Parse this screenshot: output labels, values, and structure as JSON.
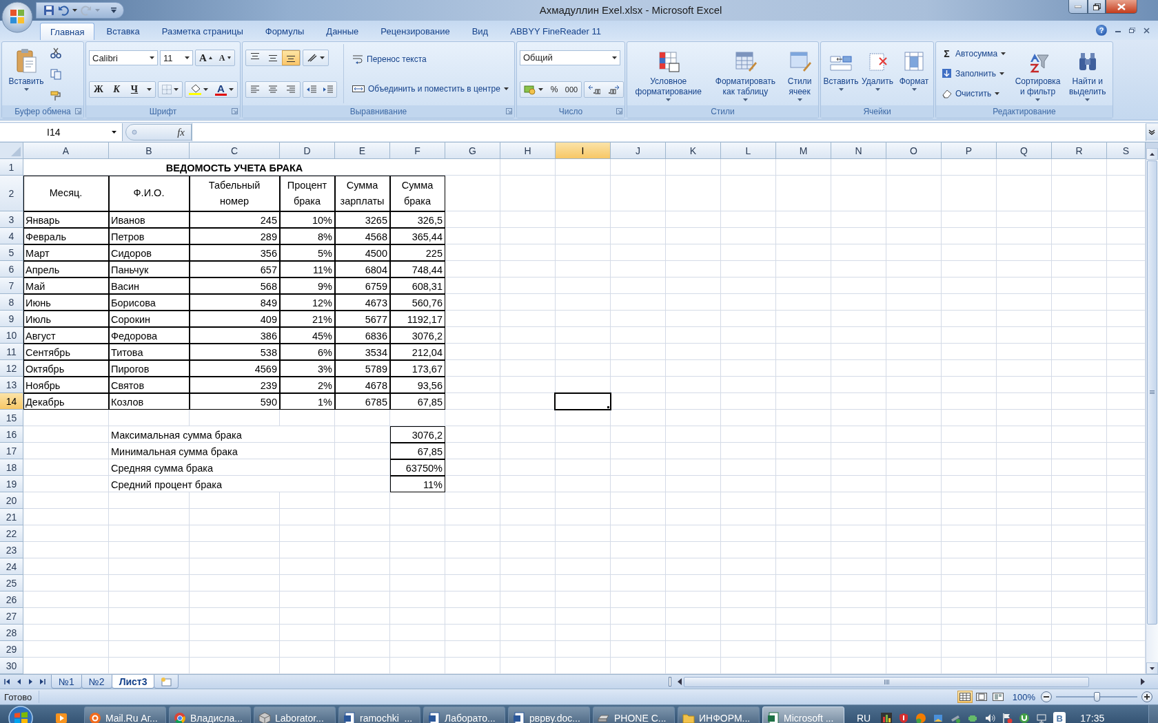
{
  "window": {
    "title": "Ахмадуллин Exel.xlsx - Microsoft Excel"
  },
  "ribbon_tabs": [
    {
      "label": "Главная",
      "selected": true
    },
    {
      "label": "Вставка",
      "selected": false
    },
    {
      "label": "Разметка страницы",
      "selected": false
    },
    {
      "label": "Формулы",
      "selected": false
    },
    {
      "label": "Данные",
      "selected": false
    },
    {
      "label": "Рецензирование",
      "selected": false
    },
    {
      "label": "Вид",
      "selected": false
    },
    {
      "label": "ABBYY FineReader 11",
      "selected": false
    }
  ],
  "help": "?",
  "ribbon": {
    "clipboard": {
      "label": "Буфер обмена",
      "paste": "Вставить"
    },
    "font": {
      "label": "Шрифт",
      "name": "Calibri",
      "size": "11",
      "grow": "A",
      "shrink": "A",
      "bold": "Ж",
      "italic": "К",
      "underline": "Ч",
      "font_color": "A"
    },
    "alignment": {
      "label": "Выравнивание",
      "vertical": [
        {
          "selected": false
        },
        {
          "selected": false
        },
        {
          "selected": true
        }
      ],
      "wrap": "Перенос текста",
      "merge": "Объединить и поместить в центре"
    },
    "number": {
      "label": "Число",
      "format": "Общий",
      "percent": "%",
      "thousands": "000"
    },
    "styles": {
      "label": "Стили",
      "buttons": [
        "Условное форматирование",
        "Форматировать как таблицу",
        "Стили ячеек"
      ]
    },
    "cells": {
      "label": "Ячейки",
      "buttons": [
        "Вставить",
        "Удалить",
        "Формат"
      ]
    },
    "editing": {
      "label": "Редактирование",
      "autosum_sign": "Σ",
      "items": [
        "Автосумма",
        "Заполнить",
        "Очистить"
      ],
      "sort": "Сортировка и фильтр",
      "find": "Найти и выделить"
    }
  },
  "formula_bar": {
    "name_box": "I14",
    "function_label": "fx"
  },
  "columns": [
    {
      "label": "A",
      "selected": false
    },
    {
      "label": "B",
      "selected": false
    },
    {
      "label": "C",
      "selected": false
    },
    {
      "label": "D",
      "selected": false
    },
    {
      "label": "E",
      "selected": false
    },
    {
      "label": "F",
      "selected": false
    },
    {
      "label": "G",
      "selected": false
    },
    {
      "label": "H",
      "selected": false
    },
    {
      "label": "I",
      "selected": true
    },
    {
      "label": "J",
      "selected": false
    },
    {
      "label": "K",
      "selected": false
    },
    {
      "label": "L",
      "selected": false
    },
    {
      "label": "M",
      "selected": false
    },
    {
      "label": "N",
      "selected": false
    },
    {
      "label": "O",
      "selected": false
    },
    {
      "label": "P",
      "selected": false
    },
    {
      "label": "Q",
      "selected": false
    },
    {
      "label": "R",
      "selected": false
    },
    {
      "label": "S",
      "selected": false
    }
  ],
  "rows": [
    {
      "header": "1",
      "selected": false,
      "kind": "title",
      "title": "ВЕДОМОСТЬ УЧЕТА БРАКА"
    },
    {
      "header": "2",
      "selected": false,
      "kind": "header",
      "cells": [
        "Месяц.",
        "Ф.И.О.",
        "Табельный номер",
        "Процент брака",
        "Сумма зарплаты",
        "Сумма брака"
      ]
    },
    {
      "header": "3",
      "selected": false,
      "kind": "data",
      "cells": [
        "Январь",
        "Иванов",
        "245",
        "10%",
        "3265",
        "326,5"
      ]
    },
    {
      "header": "4",
      "selected": false,
      "kind": "data",
      "cells": [
        "Февраль",
        "Петров",
        "289",
        "8%",
        "4568",
        "365,44"
      ]
    },
    {
      "header": "5",
      "selected": false,
      "kind": "data",
      "cells": [
        "Март",
        "Сидоров",
        "356",
        "5%",
        "4500",
        "225"
      ]
    },
    {
      "header": "6",
      "selected": false,
      "kind": "data",
      "cells": [
        "Апрель",
        "Паньчук",
        "657",
        "11%",
        "6804",
        "748,44"
      ]
    },
    {
      "header": "7",
      "selected": false,
      "kind": "data",
      "cells": [
        "Май",
        "Васин",
        "568",
        "9%",
        "6759",
        "608,31"
      ]
    },
    {
      "header": "8",
      "selected": false,
      "kind": "data",
      "cells": [
        "Июнь",
        "Борисова",
        "849",
        "12%",
        "4673",
        "560,76"
      ]
    },
    {
      "header": "9",
      "selected": false,
      "kind": "data",
      "cells": [
        "Июль",
        "Сорокин",
        "409",
        "21%",
        "5677",
        "1192,17"
      ]
    },
    {
      "header": "10",
      "selected": false,
      "kind": "data",
      "cells": [
        "Август",
        "Федорова",
        "386",
        "45%",
        "6836",
        "3076,2"
      ]
    },
    {
      "header": "11",
      "selected": false,
      "kind": "data",
      "cells": [
        "Сентябрь",
        "Титова",
        "538",
        "6%",
        "3534",
        "212,04"
      ]
    },
    {
      "header": "12",
      "selected": false,
      "kind": "data",
      "cells": [
        "Октябрь",
        "Пирогов",
        "4569",
        "3%",
        "5789",
        "173,67"
      ]
    },
    {
      "header": "13",
      "selected": false,
      "kind": "data",
      "cells": [
        "Ноябрь",
        "Святов",
        "239",
        "2%",
        "4678",
        "93,56"
      ]
    },
    {
      "header": "14",
      "selected": true,
      "kind": "data",
      "cells": [
        "Декабрь",
        "Козлов",
        "590",
        "1%",
        "6785",
        "67,85"
      ]
    },
    {
      "header": "15",
      "selected": false,
      "kind": "empty"
    },
    {
      "header": "16",
      "selected": false,
      "kind": "summary",
      "label": "Максимальная сумма брака",
      "value": "3076,2"
    },
    {
      "header": "17",
      "selected": false,
      "kind": "summary",
      "label": "Минимальная сумма брака",
      "value": "67,85"
    },
    {
      "header": "18",
      "selected": false,
      "kind": "summary",
      "label": "Средняя сумма брака",
      "value": "63750%"
    },
    {
      "header": "19",
      "selected": false,
      "kind": "summary",
      "label": "Средний процент брака",
      "value": "11%"
    },
    {
      "header": "20",
      "selected": false,
      "kind": "empty"
    },
    {
      "header": "21",
      "selected": false,
      "kind": "empty"
    },
    {
      "header": "22",
      "selected": false,
      "kind": "empty"
    },
    {
      "header": "23",
      "selected": false,
      "kind": "empty"
    },
    {
      "header": "24",
      "selected": false,
      "kind": "empty"
    },
    {
      "header": "25",
      "selected": false,
      "kind": "empty"
    },
    {
      "header": "26",
      "selected": false,
      "kind": "empty"
    },
    {
      "header": "27",
      "selected": false,
      "kind": "empty"
    },
    {
      "header": "28",
      "selected": false,
      "kind": "empty"
    },
    {
      "header": "29",
      "selected": false,
      "kind": "empty"
    },
    {
      "header": "30",
      "selected": false,
      "kind": "empty"
    }
  ],
  "sheet_tabs": [
    {
      "label": "№1",
      "selected": false
    },
    {
      "label": "№2",
      "selected": false
    },
    {
      "label": "Лист3",
      "selected": true
    }
  ],
  "status_bar": {
    "text": "Готово",
    "views": [
      {
        "selected": true
      },
      {
        "selected": false
      },
      {
        "selected": false
      }
    ],
    "zoom": "100%",
    "zoom_slider": {
      "level": 0.5
    }
  },
  "taskbar": {
    "items": [
      {
        "label": "Mail.Ru Аг...",
        "selected": false
      },
      {
        "label": "Владисла...",
        "selected": false
      },
      {
        "label": "Laborator...",
        "selected": false
      },
      {
        "label": "ramochki_...",
        "selected": false
      },
      {
        "label": "Лаборато...",
        "selected": false
      },
      {
        "label": "рврву.doc...",
        "selected": false
      },
      {
        "label": "PHONE C...",
        "selected": false
      },
      {
        "label": "ИНФОРМ...",
        "selected": false
      },
      {
        "label": "Microsoft ...",
        "selected": true
      }
    ],
    "language": "RU",
    "badge": "В",
    "time": "17:35"
  }
}
